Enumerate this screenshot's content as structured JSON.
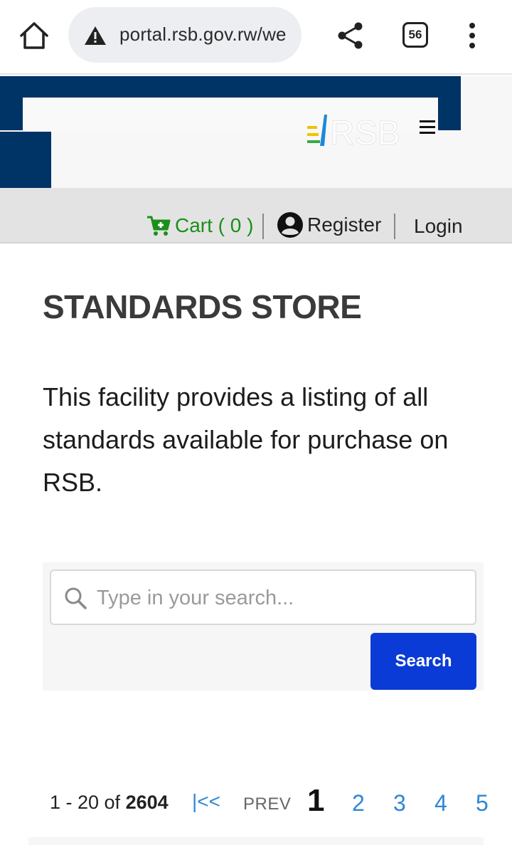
{
  "browser": {
    "url": "portal.rsb.gov.rw/we",
    "tab_count": "56"
  },
  "header": {
    "logo_text": "RSB"
  },
  "nav": {
    "cart_label": "Cart ( 0 )",
    "register_label": "Register",
    "login_label": "Login"
  },
  "main": {
    "title": "STANDARDS STORE",
    "description": "This facility provides a listing of all standards available for purchase on RSB."
  },
  "search": {
    "placeholder": "Type in your search...",
    "button_label": "Search"
  },
  "pagination": {
    "range": "1 - 20 of",
    "total": "2604",
    "first_label": "|<<",
    "prev_label": "PREV",
    "current_page": "1",
    "pages": [
      "2",
      "3",
      "4",
      "5"
    ]
  },
  "colors": {
    "brand_navy": "#003366",
    "cart_green": "#1a8f1a",
    "search_button": "#0a3bd6",
    "link_blue": "#2e86d6"
  }
}
